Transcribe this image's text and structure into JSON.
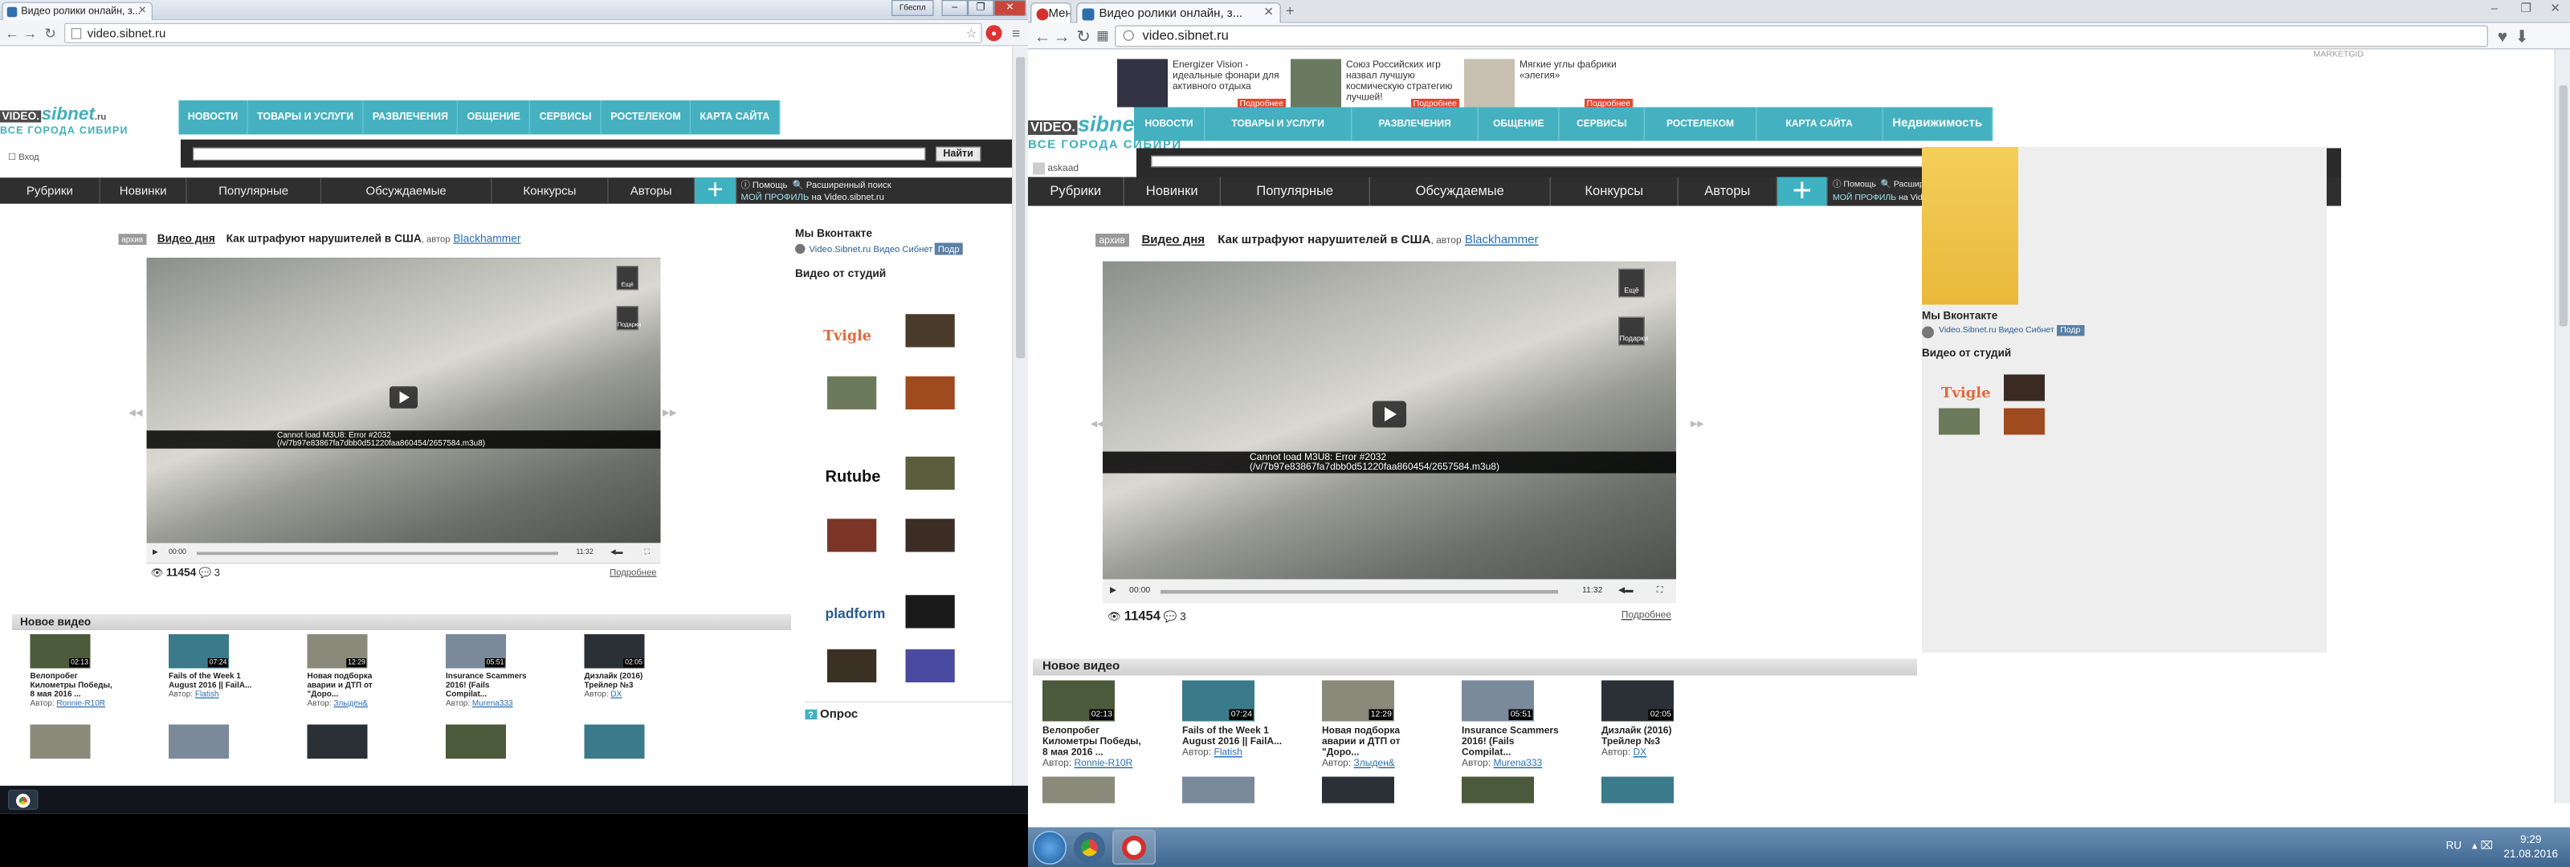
{
  "browser1": {
    "tab_title": "Видео ролики онлайн, з...",
    "url": "video.sibnet.ru",
    "lang_button": "Гбеспл"
  },
  "browser2": {
    "menu_label": "Меню",
    "tab_title": "Видео ролики онлайн, з...",
    "url": "video.sibnet.ru"
  },
  "site": {
    "logo_a": "VIDEO.",
    "logo_b": "sibnet",
    "logo_c": ".ru",
    "logo_sub": "ВСЕ ГОРОДА СИБИРИ",
    "nav": [
      "НОВОСТИ",
      "ТОВАРЫ И УСЛУГИ",
      "РАЗВЛЕЧЕНИЯ",
      "ОБЩЕНИЕ",
      "СЕРВИСЫ",
      "РОСТЕЛЕКОМ",
      "КАРТА САЙТА"
    ],
    "nav_extra": "Недвижимость",
    "login": "Вход",
    "user": "askaad",
    "search_button": "Найти",
    "rubrics": [
      "Рубрики",
      "Новинки",
      "Популярные",
      "Обсуждаемые",
      "Конкурсы",
      "Авторы"
    ],
    "plus": "+",
    "help": "Помощь",
    "adv_search": "Расширенный поиск",
    "my_profile": "МОЙ ПРОФИЛЬ",
    "on_site": "на Video.sibnet.ru",
    "archive": "архив",
    "video_of_day": "Видео дня",
    "video_title": "Как штрафуют нарушителей в США",
    "author_prefix": ", автор",
    "author": "Blackhammer",
    "more": "Ещё",
    "gifts": "Подарки",
    "error_line1": "Cannot load M3U8: Error #2032",
    "error_line2": "(/v/7b97e83867fa7dbb0d51220faa860454/2657584.m3u8)",
    "time_cur": "00:00",
    "time_total": "11:32",
    "views": "11454",
    "comments": "3",
    "more_link": "Подробнее",
    "new_video": "Новое видео",
    "vk_title": "Мы Вконтакте",
    "vk_name": "Video.Sibnet.ru Видео Сибнет",
    "vk_btn": "Подр",
    "studios_title": "Видео от студий",
    "studio_logos": [
      "Tvigle",
      "Rutube",
      "pladform"
    ],
    "poll": "Опрос",
    "marketgid": "MARKETGID"
  },
  "videos": [
    {
      "title": "Велопробег Километры Победы, 8 мая 2016 ...",
      "author": "Ronnie-R10R",
      "dur": "02:13"
    },
    {
      "title": "Fails of the Week 1 August 2016 || FailA...",
      "author": "Flatish",
      "dur": "07:24"
    },
    {
      "title": "Новая подборка аварии и ДТП от \"Доро...",
      "author": "Злыден&",
      "dur": "12:29"
    },
    {
      "title": "Insurance Scammers 2016! (Fails Compilat...",
      "author": "Murena333",
      "dur": "05:51"
    },
    {
      "title": "Дизлайк (2016) Трейлер №3",
      "author": "DX",
      "dur": "02:05"
    }
  ],
  "video_author_label": "Автор:",
  "ads": [
    {
      "text": "Energizer Vision - идеальные фонари для активного отдыха",
      "label": "Подробнее"
    },
    {
      "text": "Союз Российских игр назвал лучшую космическую стратегию лучшей!",
      "label": "Подробнее"
    },
    {
      "text": "Мягкие углы фабрики «элегия»",
      "label": "Подробнее"
    }
  ],
  "taskbar": {
    "lang": "RU",
    "time": "9:29",
    "date": "21.08.2016"
  }
}
